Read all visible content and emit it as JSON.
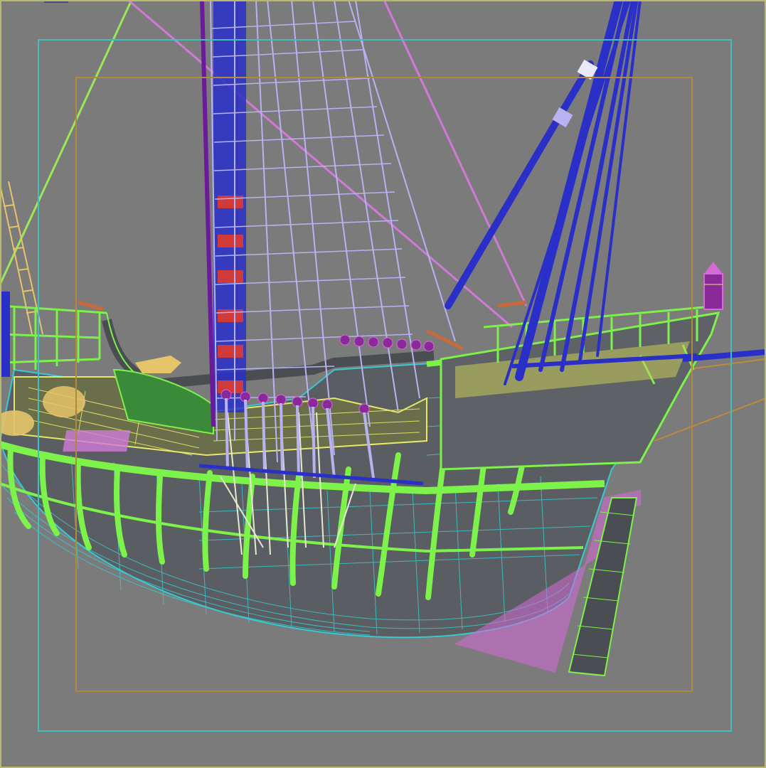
{
  "viewport": {
    "name": "3d-perspective-viewport",
    "background": "#7b7b7b",
    "mode": "wireframe-over-shaded"
  },
  "frames": {
    "safe_frame_outer_color": "#3fbfbf",
    "safe_frame_inner_color": "#b08a3a",
    "viewport_border_color": "#b9b96a"
  },
  "model": {
    "subject": "sailing-ship-hull-with-rigging",
    "colors": {
      "hull_wire": "#39c8d0",
      "hull_fill": "#5a5e62",
      "frames_green": "#7cf24a",
      "deck_yellow": "#e6e86a",
      "sails_lavender": "#b9b2f2",
      "mast_blue": "#2a2fc8",
      "rudder_magenta": "#d46ad8",
      "pins_purple": "#8a2a9a",
      "stripe_red": "#d03a3a",
      "rope_pink": "#d07ad8",
      "rope_green": "#9ae85a",
      "rope_orange": "#c08a3a"
    }
  }
}
